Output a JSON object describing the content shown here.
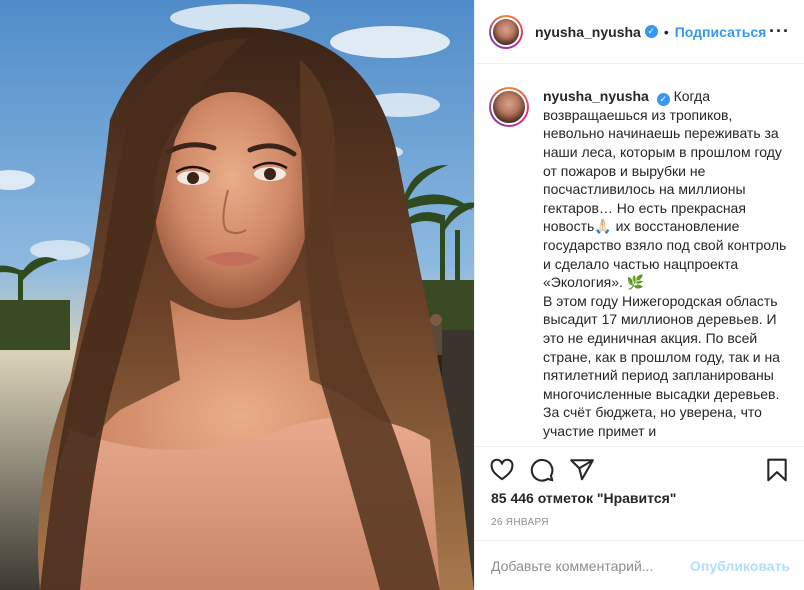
{
  "header": {
    "username": "nyusha_nyusha",
    "separator": "•",
    "follow_label": "Подписаться",
    "more_label": "···"
  },
  "caption": {
    "username": "nyusha_nyusha",
    "text": "Когда возвращаешься из тропиков, невольно начинаешь переживать за наши леса, которым в прошлом году от пожаров и вырубки не посчастливилось на миллионы гектаров… Но есть прекрасная новость🙏🏻 их восстановление государство взяло под свой контроль и сделало частью нацпроекта «Экология». 🌿",
    "text2": "В этом году Нижегородская область высадит 17 миллионов деревьев. И это не единичная акция. По всей стране, как в прошлом году, так и на пятилетний период запланированы многочисленные высадки деревьев. За счёт бюджета, но уверена, что участие примет и"
  },
  "stats": {
    "likes": "85 446 отметок \"Нравится\"",
    "date": "26 января"
  },
  "comment": {
    "placeholder": "Добавьте комментарий...",
    "publish_label": "Опубликовать"
  },
  "icons": {
    "like": "heart-icon",
    "comment": "comment-icon",
    "share": "share-icon",
    "save": "bookmark-icon",
    "verified": "verified-badge-icon"
  },
  "colors": {
    "accent": "#3897f0",
    "publish_disabled": "#b2dffc",
    "muted": "#8e8e8e",
    "text": "#262626",
    "border": "#efefef"
  }
}
